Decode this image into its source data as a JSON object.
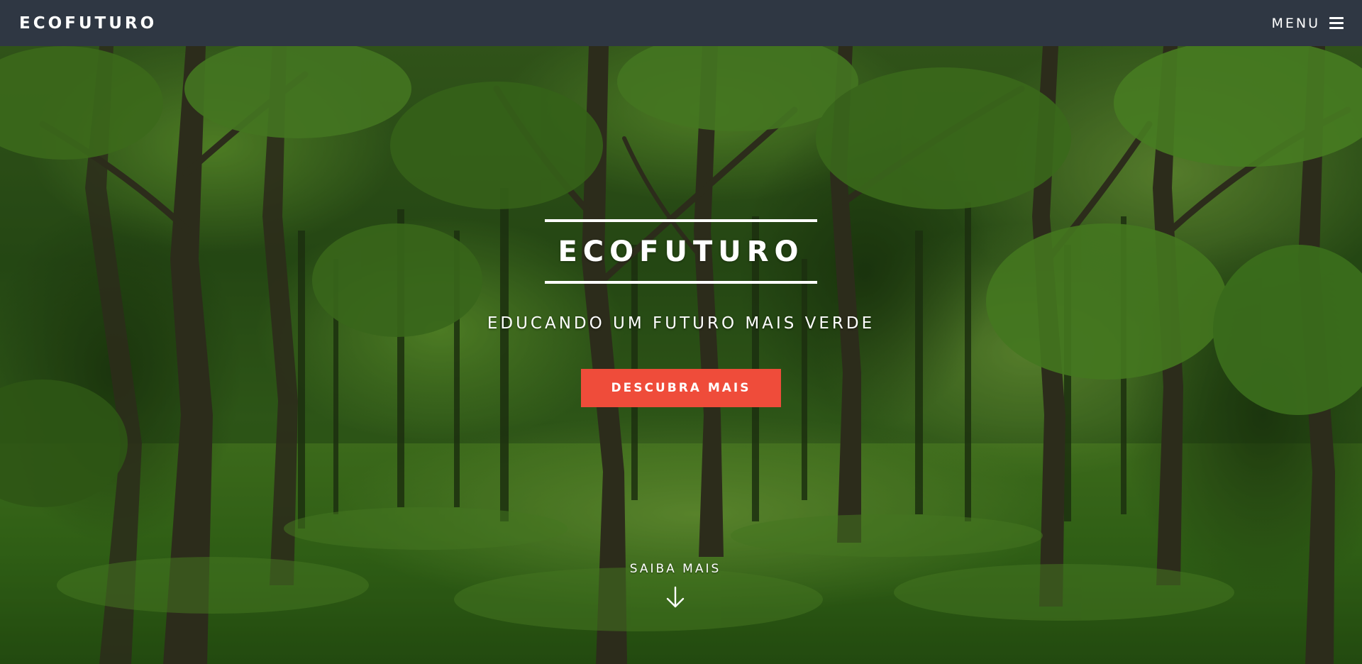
{
  "navbar": {
    "brand": "ECOFUTURO",
    "menu_label": "MENU",
    "menu_icon": "hamburger-icon"
  },
  "hero": {
    "title": "ECOFUTURO",
    "subtitle": "EDUCANDO UM FUTURO MAIS VERDE",
    "cta_label": "DESCUBRA MAIS",
    "scroll_label": "SAIBA MAIS",
    "scroll_icon": "arrow-down-icon",
    "background": "forest-photo"
  },
  "colors": {
    "navbar_bg": "#2f3743",
    "cta_bg": "#ef4c3a",
    "text": "#ffffff"
  }
}
